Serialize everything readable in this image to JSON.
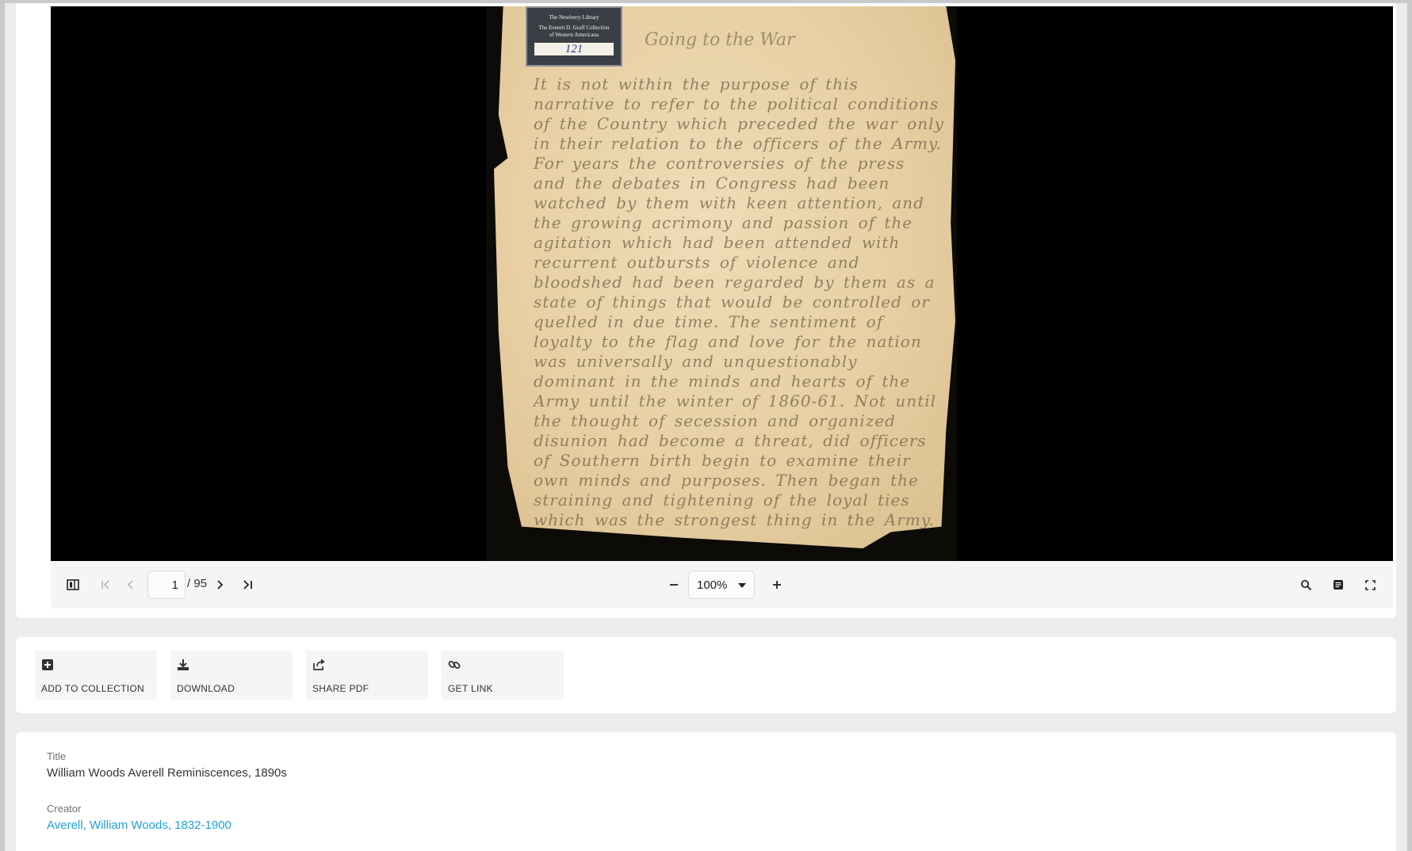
{
  "viewer": {
    "document": {
      "bookplate": {
        "line1": "The Newberry Library",
        "line2": "The Everett D. Graff Collection",
        "line3": "of Western Americana",
        "number": "121"
      },
      "handwritten_title": "Going to the War",
      "handwritten_text": "It is not within the purpose of this narrative to refer to the political conditions of the Country which preceded the war only in their relation to the officers of the Army. For years the controversies of the press and the debates in Congress had been watched by them with keen attention, and the growing acrimony and passion of the agitation which had been attended with recurrent outbursts of violence and bloodshed had been regarded by them as a state of things that would be controlled or quelled in due time. The sentiment of loyalty to the flag and love for the nation was universally and unquestionably dominant in the minds and hearts of the Army until the winter of 1860-61. Not until the thought of secession and organized disunion had become a threat, did officers of Southern birth begin to examine their own minds and purposes. Then began the straining and tightening of the loyal ties which was the strongest thing in the Army."
    },
    "toolbar": {
      "current_page": "1",
      "total_pages": "/ 95",
      "zoom": "100%"
    },
    "icons": {
      "sidebar": "sidebar-toggle-icon",
      "first": "first-page-icon",
      "prev": "previous-page-icon",
      "next": "next-page-icon",
      "last": "last-page-icon",
      "zoom_out": "zoom-out-icon",
      "zoom_in": "zoom-in-icon",
      "search": "search-icon",
      "document_properties": "document-properties-icon",
      "fullscreen": "fullscreen-icon"
    }
  },
  "actions": [
    {
      "label": "ADD TO COLLECTION",
      "icon": "plus-square-icon"
    },
    {
      "label": "DOWNLOAD",
      "icon": "download-icon"
    },
    {
      "label": "SHARE PDF",
      "icon": "share-icon"
    },
    {
      "label": "GET LINK",
      "icon": "link-icon"
    }
  ],
  "metadata": {
    "title_label": "Title",
    "title_value": "William Woods Averell Reminiscences, 1890s",
    "creator_label": "Creator",
    "creator_value": "Averell, William Woods, 1832-1900"
  },
  "colors": {
    "link": "#1e9fe0",
    "viewer_background": "#000000",
    "toolbar_background": "#f5f5f5"
  }
}
